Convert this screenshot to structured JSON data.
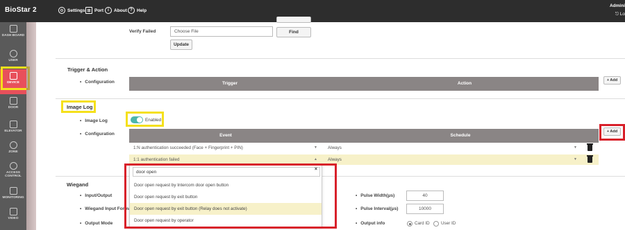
{
  "app": {
    "brand": "BioStar 2"
  },
  "topnav": {
    "settings": "Settings",
    "port": "Port",
    "about": "About",
    "help": "Help",
    "admin": "Admini",
    "logout": "Lo"
  },
  "sidebar": {
    "items": [
      {
        "label": "DASH BOARD"
      },
      {
        "label": "USER"
      },
      {
        "label": "DEVICE"
      },
      {
        "label": "DOOR"
      },
      {
        "label": "ELEVATOR"
      },
      {
        "label": "ZONE"
      },
      {
        "label": "ACCESS CONTROL"
      },
      {
        "label": "MONITORING"
      },
      {
        "label": "VIDEO"
      }
    ]
  },
  "firmware": {
    "verify_failed_label": "Verify Failed",
    "file_placeholder": "Choose File",
    "find_label": "Find",
    "update_label": "Update"
  },
  "trigger": {
    "title": "Trigger & Action",
    "configuration_label": "Configuration",
    "col_trigger": "Trigger",
    "col_action": "Action",
    "add_label": "+ Add"
  },
  "image_log": {
    "title": "Image Log",
    "image_log_label": "Image Log",
    "toggle_text": "Enabled",
    "enabled": true,
    "configuration_label": "Configuration",
    "col_event": "Event",
    "col_schedule": "Schedule",
    "add_label": "+ Add",
    "rows": [
      {
        "event": "1:N authentication succeeded (Face + Fingerprint + PIN)",
        "schedule": "Always"
      },
      {
        "event": "1:1 authentication failed",
        "schedule": "Always"
      }
    ]
  },
  "dropdown": {
    "search_value": "door open",
    "clear_icon": "×",
    "options": [
      "Door open request by Intercom door open button",
      "Door open request by exit button",
      "Door open request by exit button (Relay does not activate)",
      "Door open request by operator"
    ],
    "selected_index": 2
  },
  "wiegand": {
    "title": "Wiegand",
    "input_output_label": "Input/Output",
    "input_format_label": "Wiegand Input Format",
    "output_mode_label": "Output Mode",
    "pulse_width_label": "Pulse Width(μs)",
    "pulse_width_value": "40",
    "pulse_interval_label": "Pulse Interval(μs)",
    "pulse_interval_value": "10000",
    "output_info_label": "Output info",
    "card_id_label": "Card ID",
    "user_id_label": "User ID",
    "output_info_selected": "Card ID"
  },
  "colors": {
    "accent": "#e8505b",
    "toggle": "#4db6ac",
    "highlight_yellow": "#f5e01b",
    "highlight_red": "#d8202a",
    "table_header": "#8a8585"
  }
}
